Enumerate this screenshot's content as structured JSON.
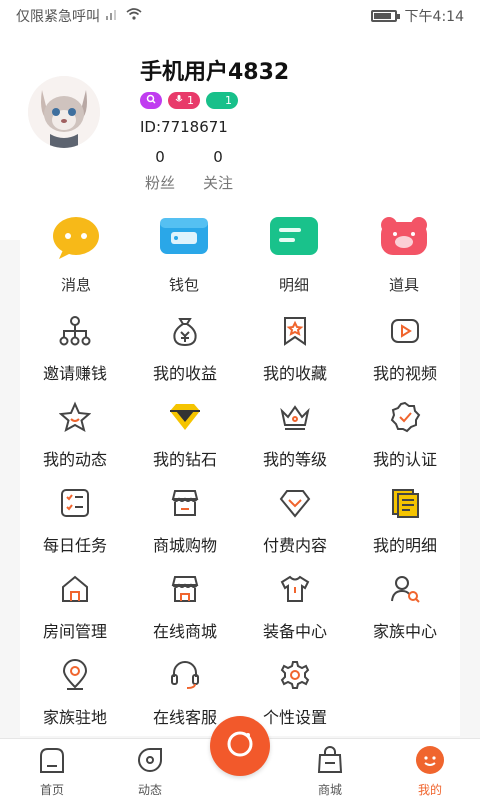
{
  "status_bar": {
    "carrier": "仅限紧急呼叫",
    "time": "下午4:14",
    "battery_level": 0.85
  },
  "profile": {
    "username": "手机用户4832",
    "user_id": "ID:7718671",
    "badges": [
      {
        "icon": "search-badge-icon",
        "value": "",
        "color": "#c03cf0"
      },
      {
        "icon": "mic-badge-icon",
        "value": "1",
        "color": "#e83a6a"
      },
      {
        "icon": "moon-badge-icon",
        "value": "1",
        "color": "#18c08a"
      }
    ],
    "stats": [
      {
        "value": "0",
        "label": "粉丝"
      },
      {
        "value": "0",
        "label": "关注"
      }
    ]
  },
  "quick_actions": [
    {
      "label": "消息",
      "icon": "message-icon",
      "color": "#f7b918"
    },
    {
      "label": "钱包",
      "icon": "wallet-icon",
      "color": "#2aa7e8"
    },
    {
      "label": "明细",
      "icon": "details-icon",
      "color": "#19c28b"
    },
    {
      "label": "道具",
      "icon": "props-icon",
      "color": "#f35466"
    }
  ],
  "features": [
    {
      "label": "邀请赚钱",
      "icon": "invite-icon"
    },
    {
      "label": "我的收益",
      "icon": "money-bag-icon"
    },
    {
      "label": "我的收藏",
      "icon": "bookmark-icon"
    },
    {
      "label": "我的视频",
      "icon": "video-icon"
    },
    {
      "label": "我的动态",
      "icon": "star-icon"
    },
    {
      "label": "我的钻石",
      "icon": "diamond-icon"
    },
    {
      "label": "我的等级",
      "icon": "crown-icon"
    },
    {
      "label": "我的认证",
      "icon": "verified-icon"
    },
    {
      "label": "每日任务",
      "icon": "task-list-icon"
    },
    {
      "label": "商城购物",
      "icon": "shop-icon"
    },
    {
      "label": "付费内容",
      "icon": "paid-content-icon"
    },
    {
      "label": "我的明细",
      "icon": "notebook-icon"
    },
    {
      "label": "房间管理",
      "icon": "home-icon"
    },
    {
      "label": "在线商城",
      "icon": "store-icon"
    },
    {
      "label": "装备中心",
      "icon": "shirt-icon"
    },
    {
      "label": "家族中心",
      "icon": "family-icon"
    },
    {
      "label": "家族驻地",
      "icon": "location-icon"
    },
    {
      "label": "在线客服",
      "icon": "headset-icon"
    },
    {
      "label": "个性设置",
      "icon": "settings-gear-icon"
    }
  ],
  "nav": [
    {
      "label": "首页",
      "icon": "home-nav-icon",
      "active": false
    },
    {
      "label": "动态",
      "icon": "moment-nav-icon",
      "active": false
    },
    {
      "label": "商城",
      "icon": "bag-nav-icon",
      "active": false
    },
    {
      "label": "我的",
      "icon": "profile-nav-icon",
      "active": true
    }
  ],
  "colors": {
    "accent": "#f2592b",
    "icon_stroke": "#444444",
    "diamond": "#f5c400"
  }
}
